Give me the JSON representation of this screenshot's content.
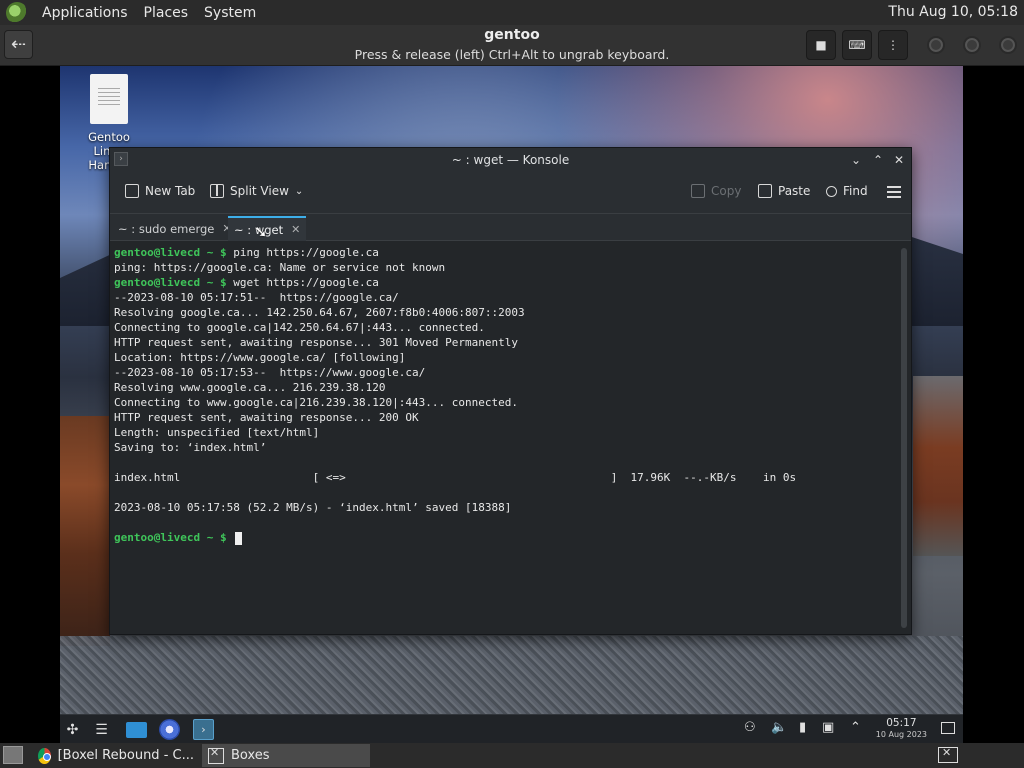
{
  "host_panel": {
    "menus": [
      "Applications",
      "Places",
      "System"
    ],
    "clock": "Thu Aug 10, 05:18"
  },
  "vm_header": {
    "title": "gentoo",
    "subtitle": "Press & release (left) Ctrl+Alt to ungrab keyboard."
  },
  "desktop": {
    "icon_label": "Gentoo Linux Hand..."
  },
  "konsole": {
    "window_title": "~ : wget — Konsole",
    "toolbar": {
      "new_tab": "New Tab",
      "split_view": "Split View",
      "copy": "Copy",
      "paste": "Paste",
      "find": "Find"
    },
    "tabs": [
      {
        "label": "~ : sudo emerge",
        "active": false
      },
      {
        "label": "~ : wget",
        "active": true
      }
    ],
    "prompt": "gentoo@livecd ~ $",
    "lines": [
      {
        "prompt": true,
        "text": " ping https://google.ca"
      },
      {
        "prompt": false,
        "text": "ping: https://google.ca: Name or service not known"
      },
      {
        "prompt": true,
        "text": " wget https://google.ca"
      },
      {
        "prompt": false,
        "text": "--2023-08-10 05:17:51--  https://google.ca/"
      },
      {
        "prompt": false,
        "text": "Resolving google.ca... 142.250.64.67, 2607:f8b0:4006:807::2003"
      },
      {
        "prompt": false,
        "text": "Connecting to google.ca|142.250.64.67|:443... connected."
      },
      {
        "prompt": false,
        "text": "HTTP request sent, awaiting response... 301 Moved Permanently"
      },
      {
        "prompt": false,
        "text": "Location: https://www.google.ca/ [following]"
      },
      {
        "prompt": false,
        "text": "--2023-08-10 05:17:53--  https://www.google.ca/"
      },
      {
        "prompt": false,
        "text": "Resolving www.google.ca... 216.239.38.120"
      },
      {
        "prompt": false,
        "text": "Connecting to www.google.ca|216.239.38.120|:443... connected."
      },
      {
        "prompt": false,
        "text": "HTTP request sent, awaiting response... 200 OK"
      },
      {
        "prompt": false,
        "text": "Length: unspecified [text/html]"
      },
      {
        "prompt": false,
        "text": "Saving to: ‘index.html’"
      },
      {
        "prompt": false,
        "text": ""
      },
      {
        "prompt": false,
        "text": "index.html                    [ <=>                                        ]  17.96K  --.-KB/s    in 0s"
      },
      {
        "prompt": false,
        "text": ""
      },
      {
        "prompt": false,
        "text": "2023-08-10 05:17:58 (52.2 MB/s) - ‘index.html’ saved [18388]"
      },
      {
        "prompt": false,
        "text": ""
      },
      {
        "prompt": true,
        "text": " ",
        "cursor": true
      }
    ]
  },
  "guest_taskbar": {
    "time": "05:17",
    "date": "10 Aug 2023"
  },
  "host_taskbar": {
    "tasks": [
      {
        "label": "[Boxel Rebound - C...",
        "icon": "chrome-icon",
        "active": false
      },
      {
        "label": "Boxes",
        "icon": "boxes-icon",
        "active": true
      }
    ]
  },
  "colors": {
    "prompt_green": "#3fc55a",
    "tab_accent": "#3daee9"
  }
}
